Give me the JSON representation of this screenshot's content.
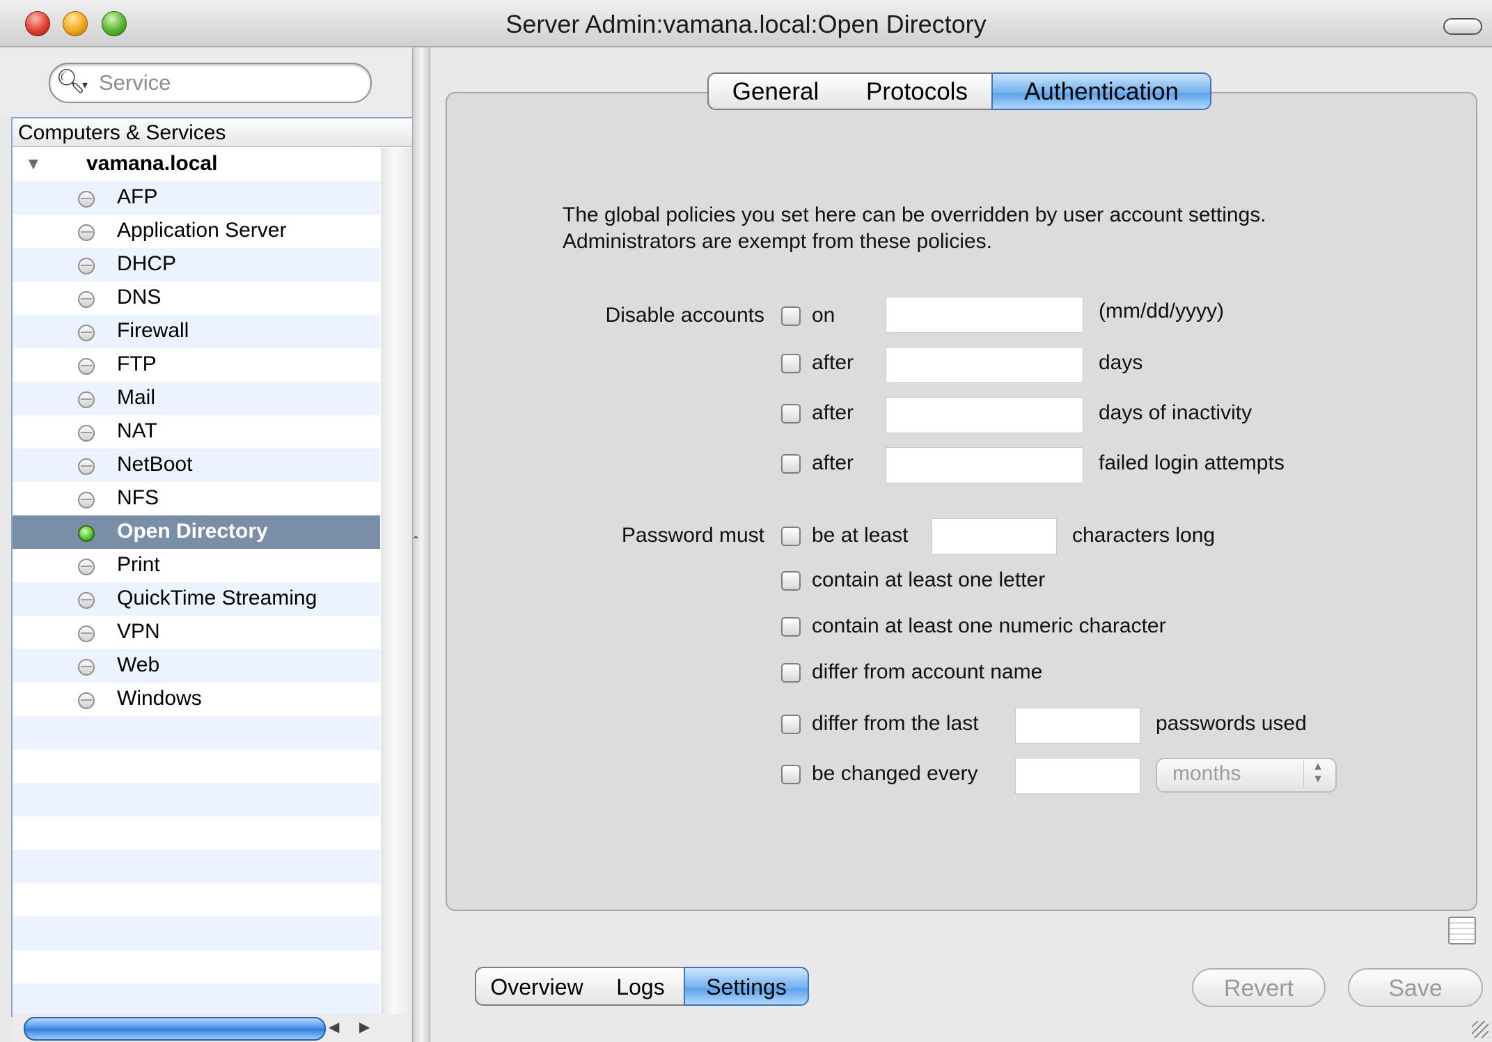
{
  "window": {
    "title": "Server Admin:vamana.local:Open Directory"
  },
  "search": {
    "placeholder": "Service"
  },
  "sidebar": {
    "header": "Computers & Services",
    "host": "vamana.local",
    "items": [
      {
        "label": "AFP",
        "selected": false
      },
      {
        "label": "Application Server",
        "selected": false
      },
      {
        "label": "DHCP",
        "selected": false
      },
      {
        "label": "DNS",
        "selected": false
      },
      {
        "label": "Firewall",
        "selected": false
      },
      {
        "label": "FTP",
        "selected": false
      },
      {
        "label": "Mail",
        "selected": false
      },
      {
        "label": "NAT",
        "selected": false
      },
      {
        "label": "NetBoot",
        "selected": false
      },
      {
        "label": "NFS",
        "selected": false
      },
      {
        "label": "Open Directory",
        "selected": true
      },
      {
        "label": "Print",
        "selected": false
      },
      {
        "label": "QuickTime Streaming",
        "selected": false
      },
      {
        "label": "VPN",
        "selected": false
      },
      {
        "label": "Web",
        "selected": false
      },
      {
        "label": "Windows",
        "selected": false
      }
    ]
  },
  "tabs": {
    "general": "General",
    "protocols": "Protocols",
    "authentication": "Authentication",
    "active": "authentication"
  },
  "description": {
    "line1": "The global policies you set here can be overridden by user account settings.",
    "line2": "Administrators are exempt from these policies."
  },
  "disable_accounts": {
    "label": "Disable accounts",
    "on_label": "on",
    "on_value": "",
    "on_suffix": "(mm/dd/yyyy)",
    "after_days_label": "after",
    "after_days_value": "",
    "after_days_suffix": "days",
    "inactivity_label": "after",
    "inactivity_value": "",
    "inactivity_suffix": "days of inactivity",
    "failed_label": "after",
    "failed_value": "",
    "failed_suffix": "failed login attempts"
  },
  "password_must": {
    "label": "Password must",
    "min_length_label": "be at least",
    "min_length_value": "",
    "min_length_suffix": "characters long",
    "letter_label": "contain at least one letter",
    "numeric_label": "contain at least one numeric character",
    "differ_name_label": "differ from account name",
    "differ_last_label": "differ from the last",
    "differ_last_value": "",
    "differ_last_suffix": "passwords used",
    "change_label": "be changed every",
    "change_value": "",
    "change_unit": "months"
  },
  "bottom_tabs": {
    "overview": "Overview",
    "logs": "Logs",
    "settings": "Settings",
    "active": "settings"
  },
  "buttons": {
    "revert": "Revert",
    "save": "Save"
  },
  "icons": {
    "search": "search-icon",
    "disclosure": "disclosure-triangle-icon",
    "status": "service-status-icon"
  }
}
